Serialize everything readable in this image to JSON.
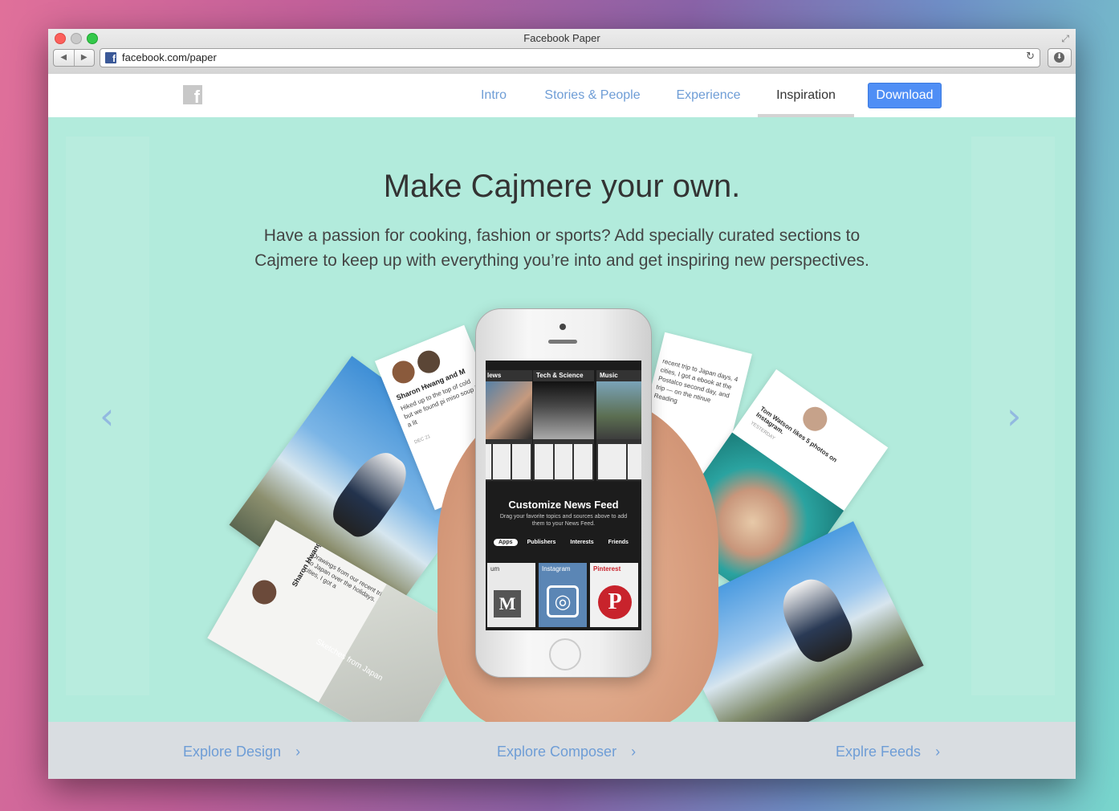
{
  "browser": {
    "title": "Facebook Paper",
    "url": "facebook.com/paper",
    "nav_back": "◀",
    "nav_forward": "▶",
    "reload_icon": "↻",
    "download_icon": "⬇",
    "fullscreen_icon": "⤢",
    "favicon": "f"
  },
  "site_nav": {
    "logo": "f",
    "items": [
      {
        "label": "Intro"
      },
      {
        "label": "Stories & People"
      },
      {
        "label": "Experience"
      },
      {
        "label": "Inspiration",
        "active": true
      }
    ],
    "download_label": "Download"
  },
  "hero": {
    "headline": "Make Cajmere your own.",
    "subtext": "Have a passion for cooking, fashion or sports? Add specially curated sections to Cajmere to keep up with everything you’re into and get inspiring new perspectives.",
    "prev_arrow": "‹",
    "next_arrow": "›"
  },
  "phone_screen": {
    "sections": [
      {
        "label": "lews"
      },
      {
        "label": "Tech & Science"
      },
      {
        "label": "Music"
      }
    ],
    "feed_title": "Customize News Feed",
    "feed_subtitle": "Drag your favorite topics and sources above to add them to your News Feed.",
    "tabs": [
      {
        "label": "Apps",
        "selected": true
      },
      {
        "label": "Publishers"
      },
      {
        "label": "Interests"
      },
      {
        "label": "Friends"
      }
    ],
    "tiles": [
      {
        "label": "um",
        "glyph": "M"
      },
      {
        "label": "Instagram",
        "glyph": "◎"
      },
      {
        "label": "Pinterest",
        "glyph": "P"
      }
    ]
  },
  "cards": {
    "left_author": "Sharon Hwang and M",
    "left_text": "Hiked up to the top of cold but we found pi miso soup in a lit",
    "left_date": "DEC 21",
    "bottom_left_author": "Sharon Hwang",
    "bottom_left_text": "Drawings from our recent trip to Japan over the holidays. 4 cities, I got a",
    "bottom_left_caption": "Sketches from Japan",
    "right_text": "recent trip to Japan days, 4 cities, I got a ebook at the Postalco second day, and trip — on the ntinue Reading",
    "right_author": "Tom Watson likes 5 photos on Instagram.",
    "right_meta": "YESTERDAY"
  },
  "footer": {
    "links": [
      {
        "label": "Explore Design"
      },
      {
        "label": "Explore Composer"
      },
      {
        "label": "Explre Feeds"
      }
    ],
    "chevron": "›"
  },
  "colors": {
    "hero_bg": "#b2ebdc",
    "link": "#6e9dd6",
    "download_bg": "#4f8ef5",
    "footer_bg": "#d9dde1"
  }
}
